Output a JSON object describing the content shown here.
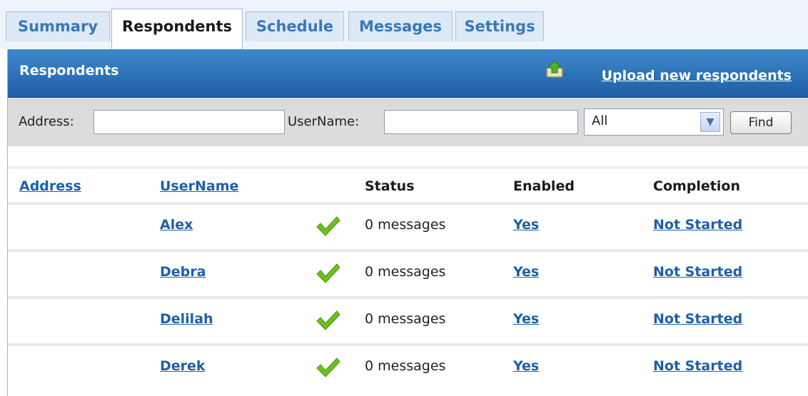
{
  "tabs": [
    {
      "label": "Summary",
      "active": false
    },
    {
      "label": "Respondents",
      "active": true
    },
    {
      "label": "Schedule",
      "active": false
    },
    {
      "label": "Messages",
      "active": false
    },
    {
      "label": "Settings",
      "active": false
    }
  ],
  "panel": {
    "title": "Respondents",
    "upload_link": "Upload new respondents"
  },
  "filters": {
    "address_label": "Address:",
    "address_value": "",
    "username_label": "UserName:",
    "username_value": "",
    "status_select_value": "All",
    "find_label": "Find"
  },
  "table": {
    "headers": {
      "address": "Address",
      "username": "UserName",
      "status": "Status",
      "enabled": "Enabled",
      "completion": "Completion"
    },
    "rows": [
      {
        "address": "",
        "username": "Alex",
        "status": "0 messages",
        "enabled": "Yes",
        "completion": "Not Started"
      },
      {
        "address": "",
        "username": "Debra",
        "status": "0 messages",
        "enabled": "Yes",
        "completion": "Not Started"
      },
      {
        "address": "",
        "username": "Delilah",
        "status": "0 messages",
        "enabled": "Yes",
        "completion": "Not Started"
      },
      {
        "address": "",
        "username": "Derek",
        "status": "0 messages",
        "enabled": "Yes",
        "completion": "Not Started"
      }
    ]
  },
  "icons": {
    "upload": "upload-icon",
    "status_ok": "checkmark-icon"
  },
  "colors": {
    "header_blue": "#1e5fa7",
    "link_blue": "#1f5fa8",
    "check_green": "#6cbf1e"
  }
}
